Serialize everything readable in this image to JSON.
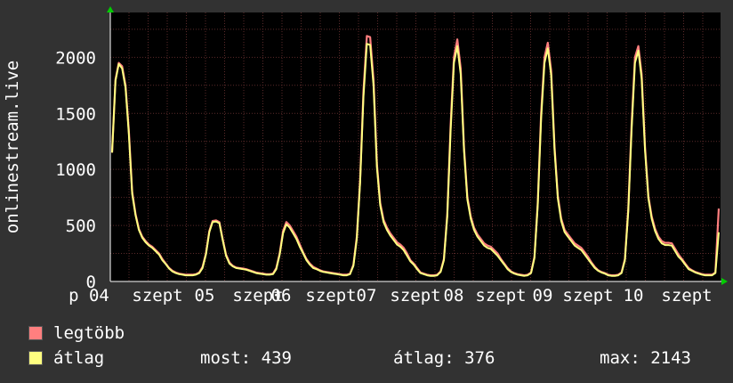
{
  "chart_data": {
    "type": "line",
    "ylabel": "onlinestream.live",
    "ylim": [
      0,
      2400
    ],
    "yticks": [
      0,
      500,
      1000,
      1500,
      2000
    ],
    "grid": true,
    "xtick_labels": [
      "p 04",
      "szept",
      "05",
      "szept",
      "06",
      "szept",
      "07",
      "szept",
      "08",
      "szept",
      "09",
      "szept",
      "10",
      "szept"
    ],
    "series": [
      {
        "name": "legtöbb",
        "color": "#ff7f7f",
        "values": [
          1150,
          1800,
          1950,
          1920,
          1750,
          1350,
          800,
          600,
          470,
          400,
          360,
          330,
          310,
          280,
          250,
          200,
          160,
          120,
          95,
          80,
          70,
          65,
          60,
          60,
          60,
          65,
          80,
          130,
          250,
          450,
          540,
          545,
          530,
          380,
          240,
          170,
          140,
          125,
          120,
          115,
          110,
          100,
          90,
          80,
          75,
          70,
          65,
          65,
          70,
          120,
          250,
          450,
          530,
          500,
          450,
          400,
          330,
          260,
          200,
          160,
          130,
          115,
          100,
          90,
          85,
          80,
          75,
          70,
          65,
          60,
          60,
          70,
          150,
          400,
          900,
          1700,
          2190,
          2180,
          1800,
          1050,
          700,
          550,
          480,
          430,
          390,
          350,
          330,
          300,
          250,
          190,
          160,
          120,
          80,
          70,
          60,
          55,
          55,
          60,
          90,
          200,
          600,
          1400,
          2000,
          2160,
          1900,
          1200,
          750,
          580,
          480,
          420,
          380,
          340,
          320,
          310,
          280,
          250,
          200,
          160,
          120,
          90,
          75,
          65,
          60,
          55,
          60,
          80,
          220,
          700,
          1500,
          2000,
          2130,
          1880,
          1200,
          760,
          560,
          460,
          420,
          380,
          340,
          320,
          300,
          260,
          220,
          170,
          130,
          100,
          85,
          75,
          60,
          55,
          55,
          60,
          80,
          200,
          650,
          1400,
          2000,
          2100,
          1850,
          1200,
          760,
          580,
          470,
          400,
          360,
          345,
          345,
          340,
          290,
          240,
          200,
          160,
          120,
          100,
          85,
          75,
          65,
          60,
          60,
          60,
          80,
          650
        ]
      },
      {
        "name": "átlag",
        "color": "#ffff80",
        "values": [
          1150,
          1790,
          1940,
          1900,
          1730,
          1320,
          780,
          590,
          460,
          390,
          350,
          320,
          300,
          270,
          240,
          190,
          155,
          115,
          90,
          75,
          65,
          60,
          55,
          55,
          55,
          60,
          75,
          120,
          240,
          440,
          530,
          535,
          520,
          370,
          230,
          160,
          135,
          120,
          115,
          110,
          105,
          95,
          85,
          75,
          70,
          65,
          60,
          60,
          65,
          110,
          240,
          430,
          510,
          480,
          430,
          380,
          310,
          250,
          190,
          150,
          120,
          110,
          95,
          85,
          80,
          75,
          70,
          65,
          60,
          55,
          55,
          65,
          140,
          380,
          880,
          1650,
          2120,
          2110,
          1750,
          1020,
          680,
          530,
          460,
          410,
          370,
          330,
          310,
          280,
          230,
          180,
          150,
          110,
          75,
          65,
          55,
          50,
          50,
          55,
          85,
          190,
          580,
          1350,
          1950,
          2100,
          1850,
          1170,
          730,
          560,
          460,
          400,
          360,
          320,
          300,
          290,
          260,
          230,
          190,
          150,
          110,
          85,
          70,
          60,
          55,
          50,
          55,
          75,
          210,
          680,
          1450,
          1950,
          2080,
          1840,
          1170,
          740,
          540,
          440,
          400,
          360,
          320,
          300,
          280,
          240,
          200,
          160,
          120,
          95,
          80,
          70,
          55,
          50,
          50,
          55,
          75,
          190,
          630,
          1350,
          1950,
          2060,
          1810,
          1170,
          740,
          560,
          450,
          380,
          340,
          325,
          325,
          320,
          270,
          220,
          190,
          150,
          110,
          95,
          80,
          70,
          60,
          55,
          55,
          55,
          75,
          439
        ]
      }
    ]
  },
  "legend": [
    {
      "label": "legtöbb",
      "color": "#ff7f7f"
    },
    {
      "label": "átlag",
      "color": "#ffff80"
    }
  ],
  "stats": {
    "current": "most: 439",
    "average": "átlag: 376",
    "maximum": "max: 2143"
  }
}
